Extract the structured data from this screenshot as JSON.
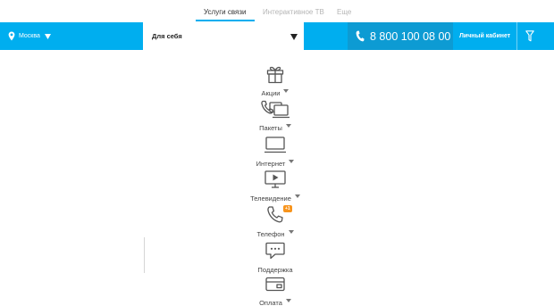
{
  "top_tabs": [
    {
      "label": "Услуги связи",
      "active": true
    },
    {
      "label": "Интерактивное ТВ",
      "active": false
    },
    {
      "label": "Еще",
      "active": false
    }
  ],
  "header": {
    "city": "Москва",
    "segment": "Для себя",
    "phone": "8 800 100 08 00",
    "cabinet": "Личный кабинет"
  },
  "menu": [
    {
      "label": "Акции",
      "icon": "gift-icon",
      "has_dropdown": true
    },
    {
      "label": "Пакеты",
      "icon": "packages-icon",
      "has_dropdown": true
    },
    {
      "label": "Интернет",
      "icon": "laptop-icon",
      "has_dropdown": true
    },
    {
      "label": "Телевидение",
      "icon": "tv-play-icon",
      "has_dropdown": true
    },
    {
      "label": "Телефон",
      "icon": "phone-icon",
      "has_dropdown": true,
      "badge": "+1"
    },
    {
      "label": "Поддержка",
      "icon": "chat-icon",
      "has_dropdown": false
    },
    {
      "label": "Оплата",
      "icon": "card-icon",
      "has_dropdown": true
    }
  ],
  "colors": {
    "accent": "#00aeef",
    "accent_dark": "#0d9bd3",
    "badge": "#f7941d",
    "icon": "#555555",
    "inactive_tab": "#b5b5b5"
  }
}
